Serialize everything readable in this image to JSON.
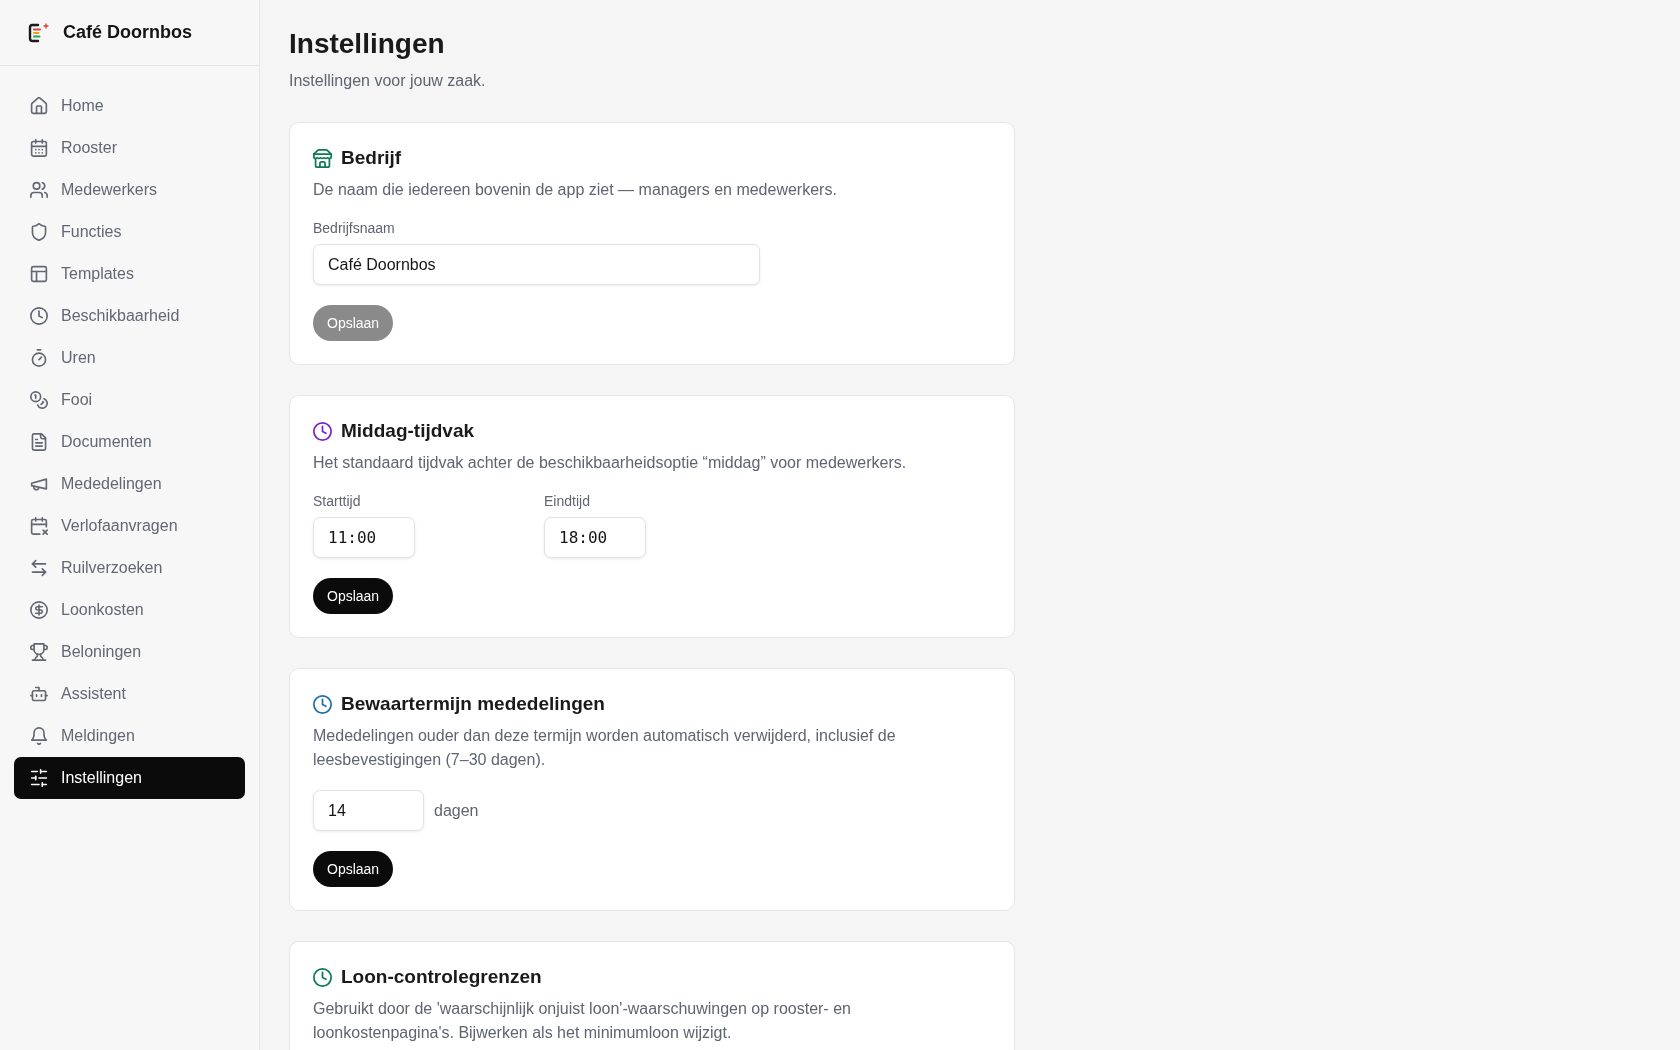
{
  "sidebar": {
    "brand": "Café Doornbos",
    "items": [
      {
        "label": "Home",
        "selected": false
      },
      {
        "label": "Rooster",
        "selected": false
      },
      {
        "label": "Medewerkers",
        "selected": false
      },
      {
        "label": "Functies",
        "selected": false
      },
      {
        "label": "Templates",
        "selected": false
      },
      {
        "label": "Beschikbaarheid",
        "selected": false
      },
      {
        "label": "Uren",
        "selected": false
      },
      {
        "label": "Fooi",
        "selected": false
      },
      {
        "label": "Documenten",
        "selected": false
      },
      {
        "label": "Mededelingen",
        "selected": false
      },
      {
        "label": "Verlofaanvragen",
        "selected": false
      },
      {
        "label": "Ruilverzoeken",
        "selected": false
      },
      {
        "label": "Loonkosten",
        "selected": false
      },
      {
        "label": "Beloningen",
        "selected": false
      },
      {
        "label": "Assistent",
        "selected": false
      },
      {
        "label": "Meldingen",
        "selected": false
      },
      {
        "label": "Instellingen",
        "selected": true
      }
    ]
  },
  "header": {
    "title": "Instellingen",
    "subtitle": "Instellingen voor jouw zaak."
  },
  "sections": [
    {
      "kind": "text",
      "title": "Bedrijf",
      "color": "#0d7a55",
      "description": "De naam die iedereen bovenin de app ziet — managers en medewerkers.",
      "fields": [
        {
          "label": "Bedrijfsnaam",
          "value": "Café Doornbos"
        }
      ],
      "button": {
        "label": "Opslaan",
        "disabled": true
      }
    },
    {
      "kind": "time_range",
      "title": "Middag-tijdvak",
      "color": "#7e22ce",
      "description": "Het standaard tijdvak achter de beschikbaarheidsoptie “middag” voor medewerkers.",
      "fields": [
        {
          "label": "Starttijd",
          "value": "11:00"
        },
        {
          "label": "Eindtijd",
          "value": "18:00"
        }
      ],
      "button": {
        "label": "Opslaan",
        "disabled": false
      }
    },
    {
      "kind": "number",
      "title": "Bewaartermijn mededelingen",
      "color": "#1f6fa8",
      "description": "Mededelingen ouder dan deze termijn worden automatisch verwijderd, inclusief de leesbevestigingen (7–30 dagen).",
      "fields": [
        {
          "value": "14",
          "unit": "dagen"
        }
      ],
      "button": {
        "label": "Opslaan",
        "disabled": false
      }
    },
    {
      "kind": "info",
      "title": "Loon-controlegrenzen",
      "color": "#0d7a55",
      "description": "Gebruikt door de 'waarschijnlijk onjuist loon'-waarschuwingen op rooster- en loonkostenpagina's. Bijwerken als het minimumloon wijzigt."
    }
  ]
}
